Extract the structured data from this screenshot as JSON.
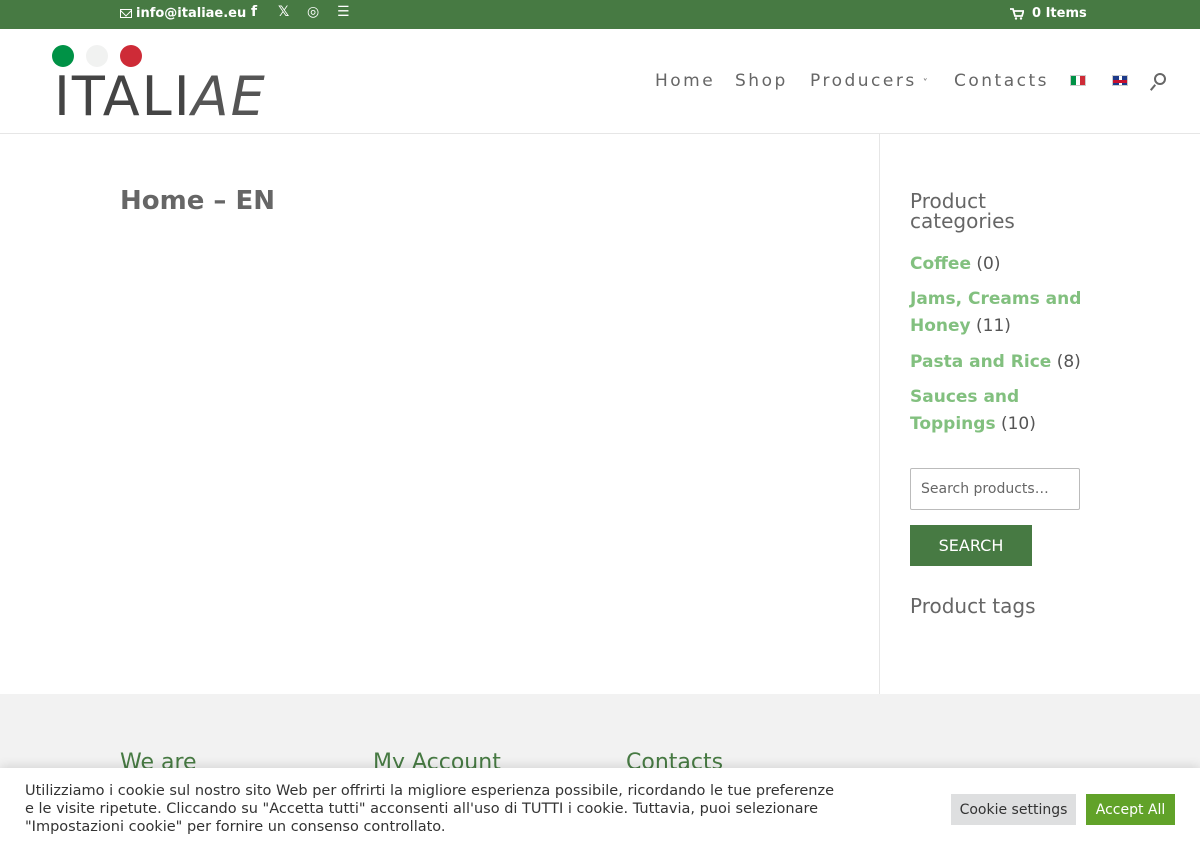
{
  "topbar": {
    "email": "info@italiae.eu",
    "social": [
      "f",
      "𝕏",
      "◎",
      "☰"
    ],
    "cart_label": "0 Items"
  },
  "logo": {
    "word_main": "ITALI",
    "word_thin": "AE",
    "colors": [
      "#009246",
      "#f1f2f1",
      "#ce2b37"
    ]
  },
  "nav": {
    "home": "Home",
    "shop": "Shop",
    "producers": "Producers",
    "contacts": "Contacts"
  },
  "main": {
    "page_title": "Home – EN"
  },
  "sidebar": {
    "categories_title": "Product categories",
    "categories": [
      {
        "name": "Coffee",
        "count": "(0)"
      },
      {
        "name": "Jams, Creams and Honey",
        "count": "(11)"
      },
      {
        "name": "Pasta and Rice",
        "count": "(8)"
      },
      {
        "name": "Sauces and Toppings",
        "count": "(10)"
      }
    ],
    "search_placeholder": "Search products…",
    "search_button": "SEARCH",
    "tags_title": "Product tags"
  },
  "footer": {
    "col1": "We are",
    "col2": "My Account",
    "col3": "Contacts"
  },
  "cookie": {
    "text": "Utilizziamo i cookie sul nostro sito Web per offrirti la migliore esperienza possibile, ricordando le tue preferenze e le visite ripetute. Cliccando su \"Accetta tutti\" acconsenti all'uso di TUTTI i cookie. Tuttavia, puoi selezionare \"Impostazioni cookie\" per fornire un consenso controllato.",
    "settings_button": "Cookie settings",
    "accept_button": "Accept All"
  },
  "colors": {
    "brand_green": "#477a43",
    "link_green": "#82c07f",
    "accept_green": "#61a229"
  }
}
